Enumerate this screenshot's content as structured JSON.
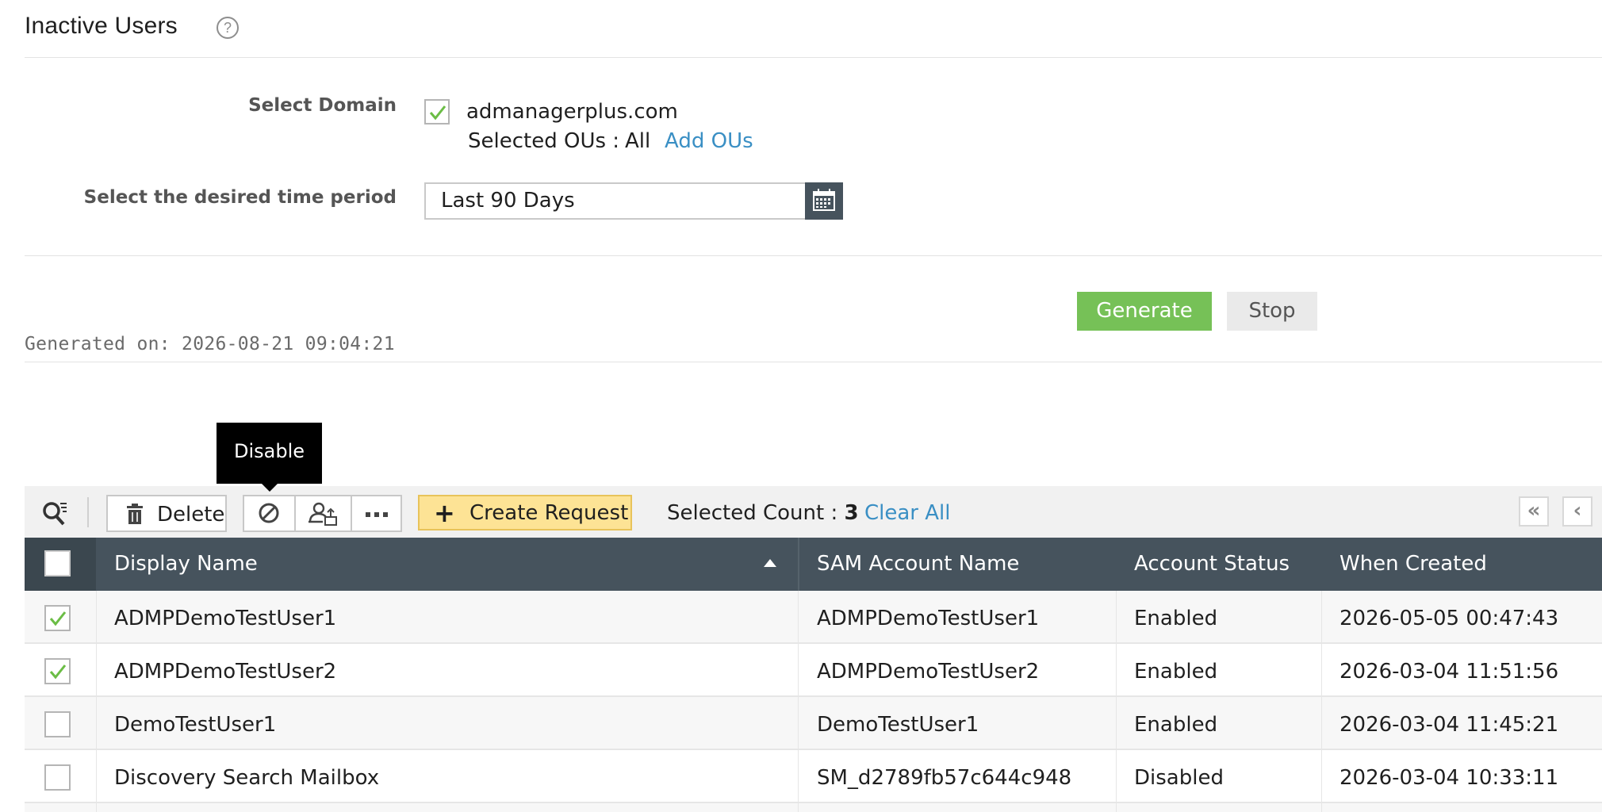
{
  "page": {
    "title": "Inactive Users"
  },
  "form": {
    "domain_label": "Select Domain",
    "domain_name": "admanagerplus.com",
    "ou_label": "Selected OUs :",
    "ou_value": "All",
    "add_ous": "Add OUs",
    "period_label": "Select the desired time period",
    "period_value": "Last 90 Days"
  },
  "actions": {
    "generate": "Generate",
    "stop": "Stop"
  },
  "generated_on": "Generated on: 2026-08-21 09:04:21",
  "tooltip": "Disable",
  "toolbar": {
    "delete": "Delete",
    "create_request": "Create Request",
    "selected_count_label": "Selected Count :",
    "selected_count": "3",
    "clear_all": "Clear All",
    "first_page": "«",
    "prev_page": "‹"
  },
  "table": {
    "columns": [
      "Display Name",
      "SAM Account Name",
      "Account Status",
      "When Created"
    ],
    "sorted_column": "Display Name",
    "rows": [
      {
        "checked": true,
        "display_name": "ADMPDemoTestUser1",
        "sam": "ADMPDemoTestUser1",
        "status": "Enabled",
        "created": "2026-05-05 00:47:43"
      },
      {
        "checked": true,
        "display_name": "ADMPDemoTestUser2",
        "sam": "ADMPDemoTestUser2",
        "status": "Enabled",
        "created": "2026-03-04 11:51:56"
      },
      {
        "checked": false,
        "display_name": "DemoTestUser1",
        "sam": "DemoTestUser1",
        "status": "Enabled",
        "created": "2026-03-04 11:45:21"
      },
      {
        "checked": false,
        "display_name": "Discovery Search Mailbox",
        "sam": "SM_d2789fb57c644c948",
        "status": "Disabled",
        "created": "2026-03-04 10:33:11"
      }
    ]
  },
  "colors": {
    "accent_link": "#3a8fc4",
    "header_bg": "#46535d",
    "generate_bg": "#76c157",
    "create_request_bg": "#fde395",
    "check_green": "#6bbd45"
  }
}
